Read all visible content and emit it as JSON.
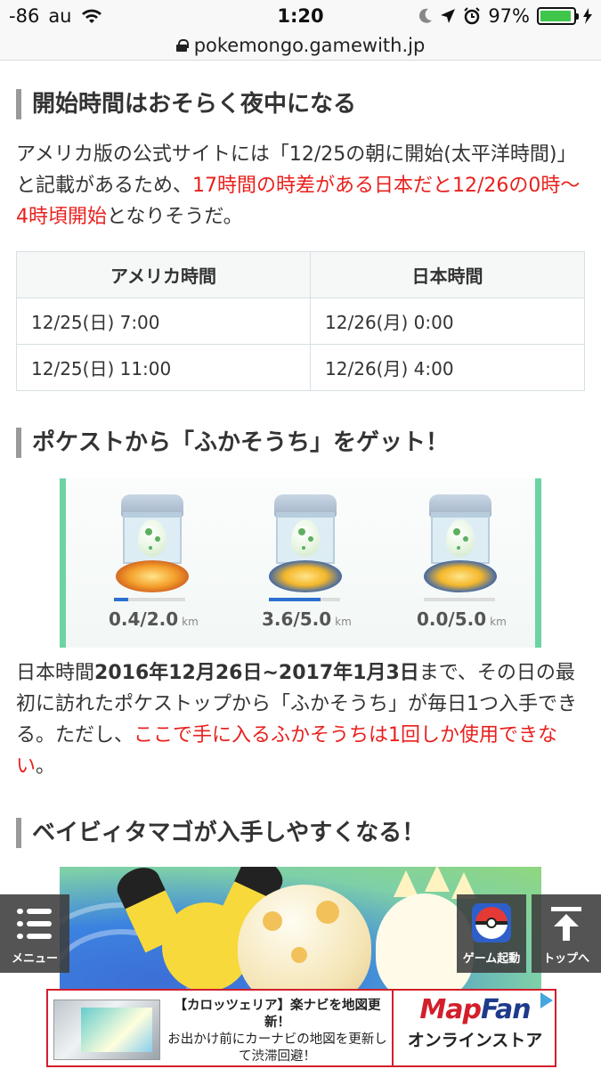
{
  "status_bar": {
    "signal": "-86",
    "carrier": "au",
    "time": "1:20",
    "battery": "97%"
  },
  "url": "pokemongo.gamewith.jp",
  "section1": {
    "heading": "開始時間はおそらく夜中になる",
    "para_before_red": "アメリカ版の公式サイトには「12/25の朝に開始(太平洋時間)」と記載があるため、",
    "para_red": "17時間の時差がある日本だと12/26の0時〜4時頃開始",
    "para_after_red": "となりそうだ。"
  },
  "table": {
    "headers": [
      "アメリカ時間",
      "日本時間"
    ],
    "rows": [
      [
        "12/25(日) 7:00",
        "12/26(月) 0:00"
      ],
      [
        "12/25(日) 11:00",
        "12/26(月) 4:00"
      ]
    ]
  },
  "section2": {
    "heading": "ポケストから「ふかそうち」をゲット！",
    "eggs": [
      {
        "value": "0.4/2.0",
        "unit": "km",
        "progress": 0.2
      },
      {
        "value": "3.6/5.0",
        "unit": "km",
        "progress": 0.72
      },
      {
        "value": "0.0/5.0",
        "unit": "km",
        "progress": 0.0
      }
    ],
    "para_prefix": "日本時間",
    "para_bold": "2016年12月26日~2017年1月3日",
    "para_middle": "まで、その日の最初に訪れたポケストップから「ふかそうち」が毎日1つ入手できる。ただし、",
    "para_red": "ここで手に入るふかそうちは1回しか使用できない",
    "para_end": "。"
  },
  "section3": {
    "heading": "ベイビィタマゴが入手しやすくなる！"
  },
  "floating": {
    "menu_label": "メニュー",
    "game_label": "ゲーム起動",
    "top_label": "トップへ"
  },
  "ad": {
    "title": "【カロッツェリア】楽ナビを地図更新！",
    "body": "お出かけ前にカーナビの地図を更新して渋滞回避！",
    "brand_map": "Map",
    "brand_fan": "Fan",
    "brand_sub": "オンラインストア"
  },
  "colors": {
    "accent_red": "#e8201d",
    "ad_red": "#d21f2b",
    "battery_green": "#3fc64a",
    "panel_border_green": "#6dd3a3"
  }
}
